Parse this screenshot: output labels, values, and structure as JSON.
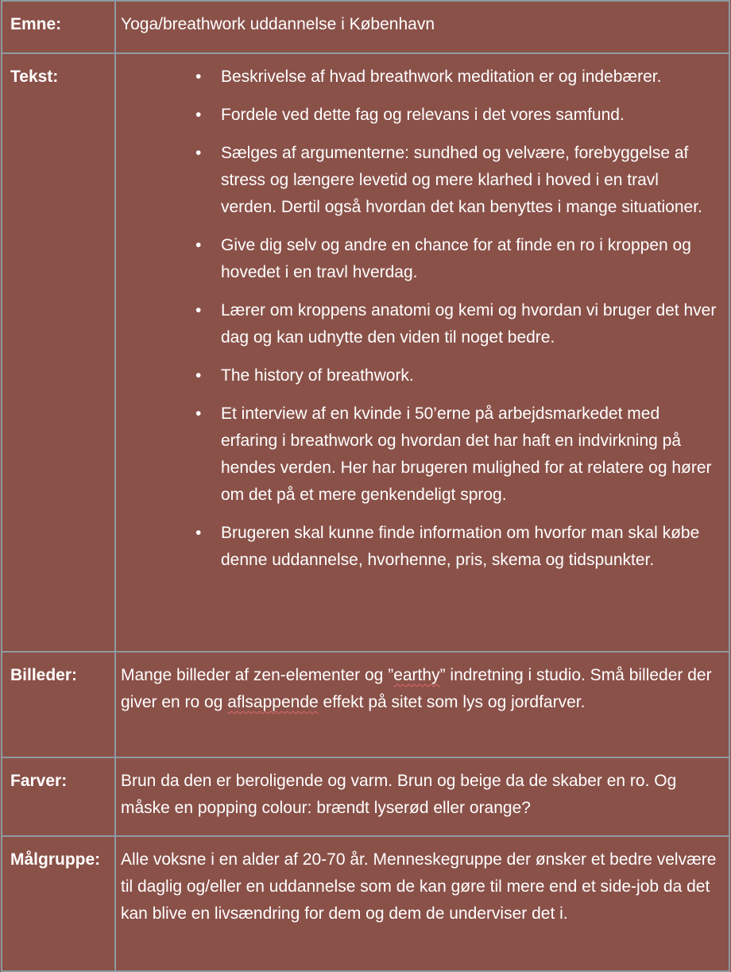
{
  "rows": {
    "emne": {
      "label": "Emne:",
      "value": "Yoga/breathwork uddannelse i København"
    },
    "tekst": {
      "label": "Tekst:",
      "bullets": [
        "Beskrivelse af hvad breathwork meditation er og indebærer.",
        "Fordele ved dette fag og relevans i det vores samfund.",
        "Sælges af argumenterne: sundhed og velvære, forebyggelse af stress og længere levetid og mere klarhed i hoved i en travl verden. Dertil også hvordan det kan benyttes i mange situationer.",
        "Give dig selv og andre en chance for at finde en ro i kroppen og hovedet i en travl hverdag.",
        "Lærer om kroppens anatomi og kemi og hvordan vi bruger det hver dag og kan udnytte den viden til noget bedre.",
        "The history of breathwork.",
        "Et interview af en kvinde i 50’erne på arbejdsmarkedet med erfaring i breathwork og hvordan det har haft en indvirkning på hendes verden. Her har brugeren mulighed for at relatere og hører om det på et mere genkendeligt sprog.",
        "Brugeren skal kunne finde information om hvorfor man skal købe denne uddannelse, hvorhenne, pris, skema og tidspunkter."
      ]
    },
    "billeder": {
      "label": "Billeder:",
      "part1": "Mange billeder af zen-elementer og ”",
      "word1": "earthy",
      "part2": "” indretning i studio. Små billeder der giver en ro og ",
      "word2": "aflsappende",
      "part3": " effekt på sitet som lys og jordfarver."
    },
    "farver": {
      "label": "Farver:",
      "value": "Brun da den er beroligende og varm. Brun og beige da de skaber en ro. Og måske en popping colour: brændt lyserød eller orange?"
    },
    "maalgruppe": {
      "label": "Målgruppe:",
      "value": "Alle voksne i en alder af 20-70 år. Menneskegruppe der ønsker et bedre velvære til daglig og/eller en uddannelse som de kan gøre til mere end et side-job da det kan blive en livsændring for dem og dem de underviser det i."
    }
  },
  "colors": {
    "background": "#8a5149",
    "border": "#8e9aa2",
    "text": "#ffffff",
    "spellcheck": "#e06a6a"
  }
}
